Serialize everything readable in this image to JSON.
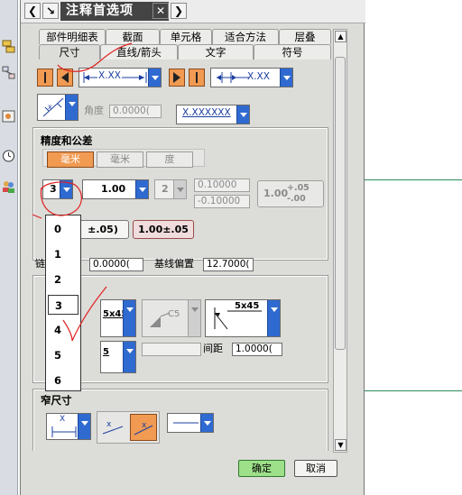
{
  "window": {
    "title": "注释首选项",
    "titlebar_icons": [
      "chevron-left-icon",
      "pin-arrow-icon",
      "close-icon",
      "chevron-right-icon"
    ]
  },
  "tabs": {
    "row1": [
      "部件明细表",
      "截面",
      "单元格",
      "适合方法",
      "层叠"
    ],
    "row2": [
      "尺寸",
      "直线/箭头",
      "文字",
      "符号"
    ],
    "active": "尺寸"
  },
  "toolbar": {
    "angle_label": "角度",
    "angle_value": "0.0000(",
    "dim_text_sample": "X.XX",
    "dim_text_sample2": "X.XX",
    "format_sample": "X.XXXXXX"
  },
  "precision_group": {
    "title": "精度和公差",
    "units": [
      "毫米",
      "毫米",
      "度"
    ],
    "precision_value": "3",
    "nominal_value": "1.00",
    "tolerance_precision": "2",
    "upper_tol": "0.10000",
    "lower_tol": "-0.10000",
    "tolerance_preview": "1.00",
    "tolerance_preview_upper": "+.05",
    "tolerance_preview_lower": "-.00",
    "btn_limit_partial": "±.05)",
    "btn_bilateral": "1.00±.05"
  },
  "precision_dropdown": {
    "options": [
      "0",
      "1",
      "2",
      "3",
      "4",
      "5",
      "6"
    ],
    "selected": "3"
  },
  "offset_row": {
    "label_partial": "链",
    "offset_value": "0.0000(",
    "baseline_label": "基线偏置",
    "baseline_value": "12.7000("
  },
  "chamfer_group": {
    "chamfer_sample_1": "5x45",
    "chamfer_sample_2": "C5",
    "chamfer_sample_3": "5x45",
    "chamfer_sample_4": "5",
    "spacing_label": "间距",
    "spacing_value": "1.0000("
  },
  "narrow_group": {
    "title": "窄尺寸",
    "sample_label": "X"
  },
  "buttons": {
    "ok": "确定",
    "cancel": "取消"
  },
  "colors": {
    "accent_orange": "#f09a52",
    "dropdown_blue": "#2f6ad1",
    "ok_green": "#9ee08a",
    "annotation_red": "#e02020"
  }
}
